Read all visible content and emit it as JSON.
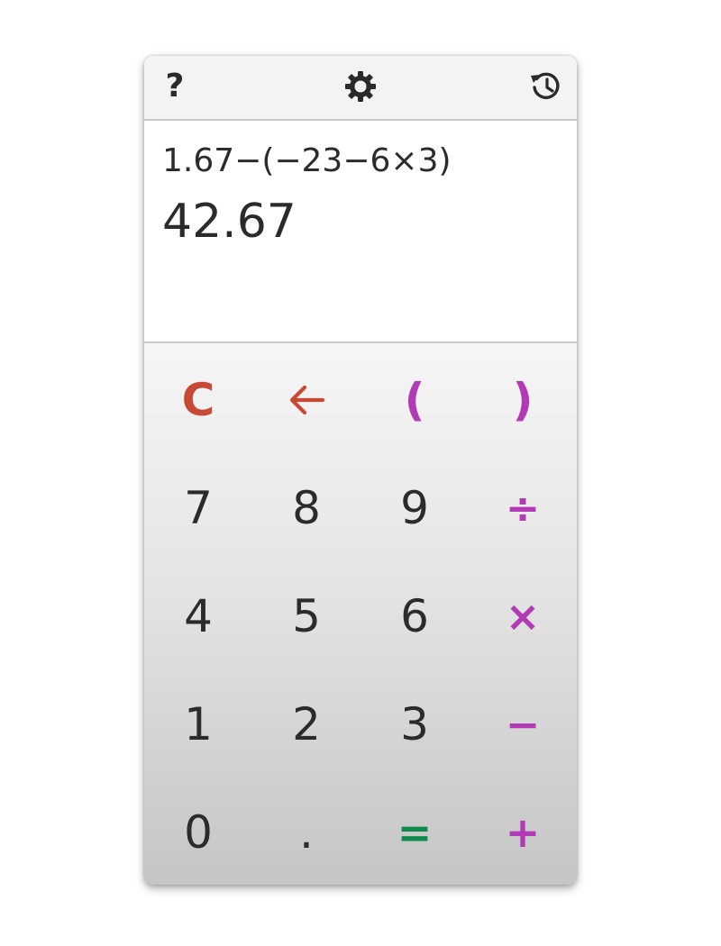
{
  "colors": {
    "clear": "#c84a35",
    "operator": "#b23bb5",
    "equals": "#0f8a4c",
    "digit": "#2b2b2b",
    "toolbar_bg": "#f3f3f3"
  },
  "toolbar": {
    "help_icon": "question-mark-icon",
    "help_label": "?",
    "settings_icon": "gear-icon",
    "history_icon": "history-icon"
  },
  "display": {
    "expression": "1.67−(−23−6×3)",
    "result": "42.67"
  },
  "keypad": {
    "rows": [
      [
        "C",
        "🡐",
        "(",
        ")"
      ],
      [
        "7",
        "8",
        "9",
        "÷"
      ],
      [
        "4",
        "5",
        "6",
        "×"
      ],
      [
        "1",
        "2",
        "3",
        "−"
      ],
      [
        "0",
        ".",
        "=",
        "+"
      ]
    ]
  }
}
